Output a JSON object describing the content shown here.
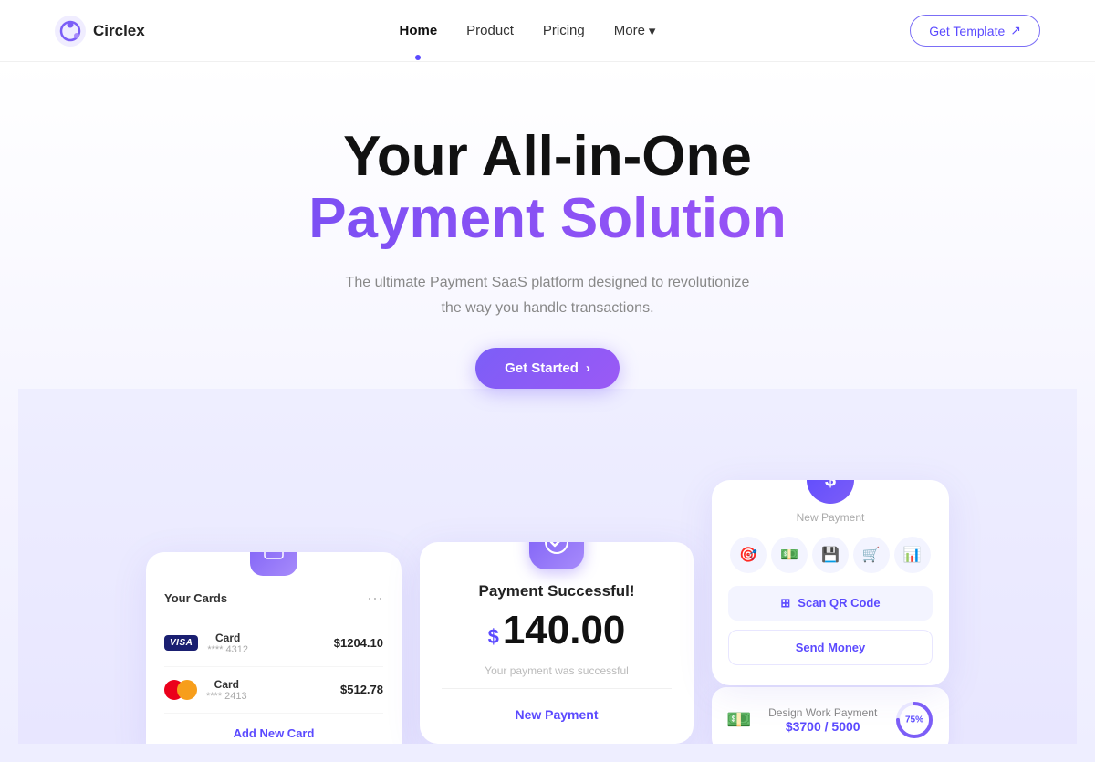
{
  "nav": {
    "logo_text": "Circlex",
    "links": [
      {
        "label": "Home",
        "active": true
      },
      {
        "label": "Product",
        "active": false
      },
      {
        "label": "Pricing",
        "active": false
      },
      {
        "label": "More",
        "active": false,
        "has_dropdown": true
      }
    ],
    "cta_label": "Get Template",
    "cta_icon": "↗"
  },
  "hero": {
    "title_line1": "Your All-in-One",
    "title_line2": "Payment Solution",
    "subtitle_line1": "The ultimate Payment SaaS platform designed to revolutionize",
    "subtitle_line2": "the way you handle transactions.",
    "cta_label": "Get Started"
  },
  "your_cards_panel": {
    "title": "Your Cards",
    "cards": [
      {
        "brand": "VISA",
        "name": "Card",
        "number": "**** 4312",
        "amount": "$1204.10"
      },
      {
        "brand": "MC",
        "name": "Card",
        "number": "**** 2413",
        "amount": "$512.78"
      }
    ],
    "add_label": "Add New Card"
  },
  "payment_success_panel": {
    "title": "Payment Successful!",
    "dollar_sign": "$",
    "amount": "140.00",
    "note": "Your payment was successful",
    "new_payment_label": "New Payment"
  },
  "new_payment_panel": {
    "title": "New Payment",
    "icons": [
      "🎯",
      "💵",
      "💾",
      "🛒",
      "📊"
    ],
    "scan_label": "Scan QR Code",
    "send_label": "Send Money"
  },
  "design_payment": {
    "title": "Design Work Payment",
    "current": "$3700",
    "total": "5000",
    "progress": 75,
    "progress_color": "#7c5ef7"
  }
}
